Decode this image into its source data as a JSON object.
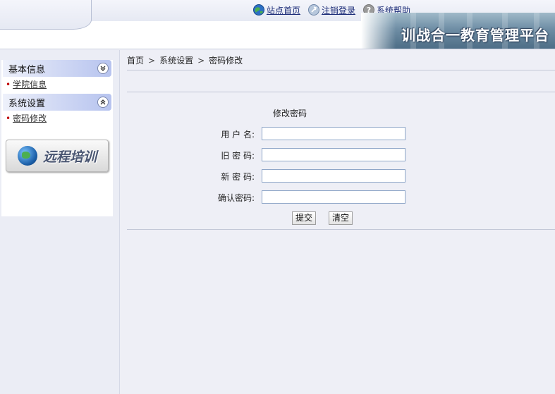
{
  "header": {
    "links": [
      {
        "label": "站点首页",
        "icon": "globe-icon"
      },
      {
        "label": "注销登录",
        "icon": "logout-icon"
      },
      {
        "label": "系统帮助",
        "icon": "help-icon"
      }
    ],
    "banner_title": "训战合一教育管理平台"
  },
  "sidebar": {
    "groups": [
      {
        "label": "基本信息",
        "chevron": "collapse",
        "items": [
          "学院信息"
        ]
      },
      {
        "label": "系统设置",
        "chevron": "expand",
        "items": [
          "密码修改"
        ]
      }
    ],
    "remote_button": "远程培训"
  },
  "main": {
    "breadcrumb": [
      "首页",
      "系统设置",
      "密码修改"
    ],
    "form_title": "修改密码",
    "fields": [
      {
        "label": "用 户 名:",
        "value": ""
      },
      {
        "label": "旧 密 码:",
        "value": ""
      },
      {
        "label": "新 密 码:",
        "value": ""
      },
      {
        "label": "确认密码:",
        "value": ""
      }
    ],
    "submit_label": "提交",
    "clear_label": "清空"
  },
  "colors": {
    "page_bg": "#eeeff6",
    "menu_header_accent": "#b7c4ef",
    "link_color": "#1b2b77",
    "bullet_red": "#c00000",
    "input_border": "#8fa6c8"
  }
}
